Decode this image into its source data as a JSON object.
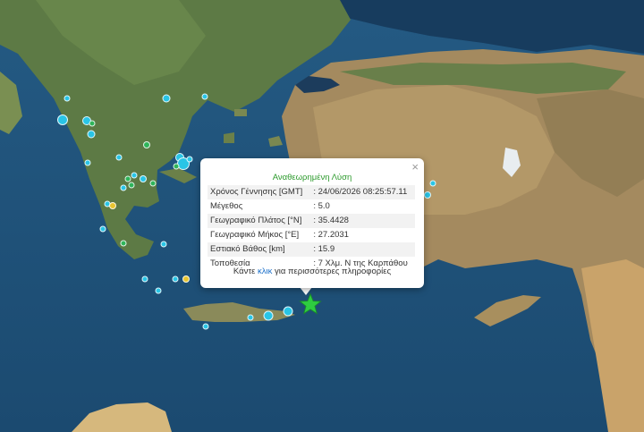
{
  "popup": {
    "title": "Αναθεωρημένη Λύση",
    "close_symbol": "×",
    "rows": [
      {
        "label": "Χρόνος Γέννησης [GMT]",
        "value": ": 24/06/2026 08:25:57.11"
      },
      {
        "label": "Μέγεθος",
        "value": ": 5.0"
      },
      {
        "label": "Γεωγραφικό Πλάτος [°N]",
        "value": ": 35.4428"
      },
      {
        "label": "Γεωγραφικό Μήκος [°E]",
        "value": ": 27.2031"
      },
      {
        "label": "Εστιακό Βάθος [km]",
        "value": ": 15.9"
      },
      {
        "label": "Τοποθεσία",
        "value": ": 7 Χλμ. N της Καρπάθου"
      }
    ],
    "more_prefix": "Κάντε",
    "more_link": "κλικ",
    "more_suffix": "για περισσότερες πληροφορίες"
  },
  "marker_colors": {
    "main_event": "#2ecc40",
    "recent": "#29c5e6",
    "day": "#2fb45a",
    "week": "#e8c531"
  }
}
